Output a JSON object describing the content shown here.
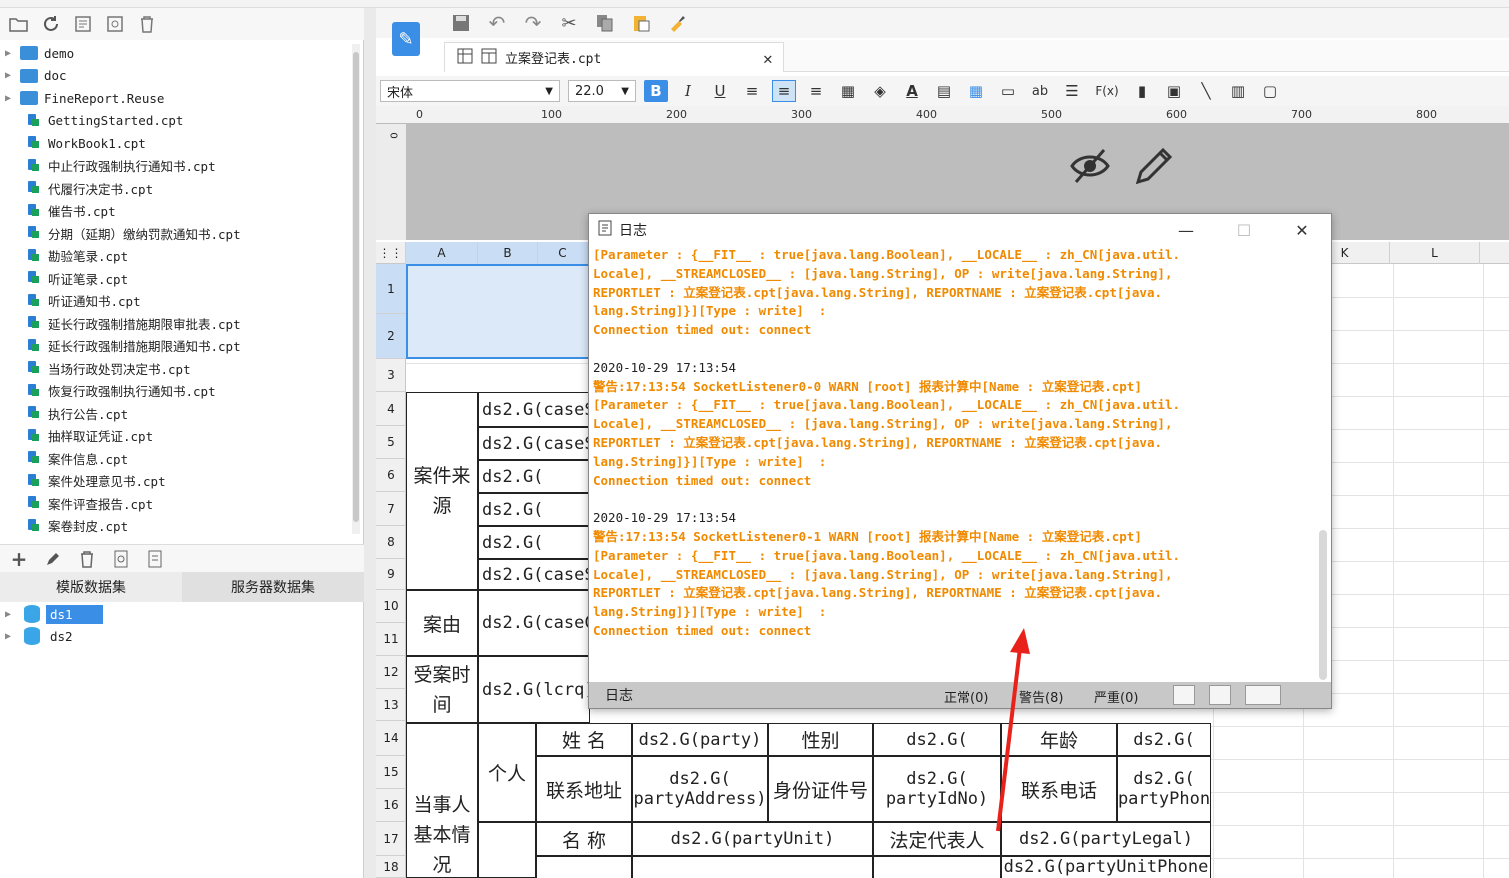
{
  "left_toolbar_icons": [
    "open-folder-icon",
    "refresh-icon",
    "new-template-icon",
    "settings-icon",
    "delete-icon"
  ],
  "file_tree": [
    {
      "type": "folder",
      "label": "demo"
    },
    {
      "type": "folder",
      "label": "doc"
    },
    {
      "type": "folder",
      "label": "FineReport.Reuse"
    },
    {
      "type": "file",
      "label": "GettingStarted.cpt"
    },
    {
      "type": "file",
      "label": "WorkBook1.cpt"
    },
    {
      "type": "file",
      "label": "中止行政强制执行通知书.cpt"
    },
    {
      "type": "file",
      "label": "代履行决定书.cpt"
    },
    {
      "type": "file",
      "label": "催告书.cpt"
    },
    {
      "type": "file",
      "label": "分期（延期）缴纳罚款通知书.cpt"
    },
    {
      "type": "file",
      "label": "勘验笔录.cpt"
    },
    {
      "type": "file",
      "label": "听证笔录.cpt"
    },
    {
      "type": "file",
      "label": "听证通知书.cpt"
    },
    {
      "type": "file",
      "label": "延长行政强制措施期限审批表.cpt"
    },
    {
      "type": "file",
      "label": "延长行政强制措施期限通知书.cpt"
    },
    {
      "type": "file",
      "label": "当场行政处罚决定书.cpt"
    },
    {
      "type": "file",
      "label": "恢复行政强制执行通知书.cpt"
    },
    {
      "type": "file",
      "label": "执行公告.cpt"
    },
    {
      "type": "file",
      "label": "抽样取证凭证.cpt"
    },
    {
      "type": "file",
      "label": "案件信息.cpt"
    },
    {
      "type": "file",
      "label": "案件处理意见书.cpt"
    },
    {
      "type": "file",
      "label": "案件评查报告.cpt"
    },
    {
      "type": "file",
      "label": "案卷封皮.cpt"
    }
  ],
  "dataset_tabs": {
    "template": "模版数据集",
    "server": "服务器数据集"
  },
  "datasets": [
    "ds1",
    "ds2"
  ],
  "editor_tab": {
    "title": "立案登记表.cpt"
  },
  "font": {
    "name": "宋体",
    "size": "22.0"
  },
  "format_buttons": {
    "bold": "B",
    "italic": "I",
    "underline": "U",
    "text": "ab",
    "formula": "F(x)"
  },
  "ruler_marks": [
    "0",
    "100",
    "200",
    "300",
    "400",
    "500",
    "600",
    "700",
    "800"
  ],
  "columns": [
    "A",
    "B",
    "C",
    "K",
    "L"
  ],
  "rows": [
    "1",
    "2",
    "3",
    "4",
    "5",
    "6",
    "7",
    "8",
    "9",
    "10",
    "11",
    "12",
    "13",
    "14",
    "15",
    "16",
    "17",
    "18"
  ],
  "cells": {
    "case_source": "案件来源",
    "cause": "案由",
    "accept_time": "受案时间",
    "party_info": "当事人基本情况",
    "individual": "个人",
    "name": "姓 名",
    "sex": "性别",
    "age": "年龄",
    "address": "联系地址",
    "id_no": "身份证件号",
    "phone": "联系电话",
    "unit_name": "名 称",
    "legal_rep": "法定代表人",
    "c4": "ds2.G(caseS",
    "c5": "ds2.G(caseS",
    "c6": "ds2.G(",
    "c7": "ds2.G(",
    "c8": "ds2.G(",
    "c9": "ds2.G(caseS",
    "c10": "ds2.G(caseC",
    "c12": "ds2.G(lcrq)",
    "party": "ds2.G(party)",
    "g_sex": "ds2.G(",
    "g_age": "ds2.G(",
    "g_addr1": "ds2.G(",
    "g_addr2": "partyAddress)",
    "g_id1": "ds2.G(",
    "g_id2": "partyIdNo)",
    "g_phone1": "ds2.G(",
    "g_phone2": "partyPhon",
    "unit": "ds2.G(partyUnit)",
    "legal": "ds2.G(partyLegal)",
    "unit_phone": "ds2.G(partyUnitPhone"
  },
  "log_window": {
    "title": "日志",
    "entries": [
      {
        "time": "",
        "lines": [
          "[Parameter : {__FIT__ : true[java.lang.Boolean], __LOCALE__ : zh_CN[java.util.",
          "Locale], __STREAMCLOSED__ : [java.lang.String], OP : write[java.lang.String],",
          "REPORTLET : 立案登记表.cpt[java.lang.String], REPORTNAME : 立案登记表.cpt[java.",
          "lang.String]}][Type : write]  :",
          "Connection timed out: connect"
        ]
      },
      {
        "time": "2020-10-29 17:13:54",
        "lines": [
          "警告:17:13:54 SocketListener0-0 WARN [root] 报表计算中[Name : 立案登记表.cpt]",
          "[Parameter : {__FIT__ : true[java.lang.Boolean], __LOCALE__ : zh_CN[java.util.",
          "Locale], __STREAMCLOSED__ : [java.lang.String], OP : write[java.lang.String],",
          "REPORTLET : 立案登记表.cpt[java.lang.String], REPORTNAME : 立案登记表.cpt[java.",
          "lang.String]}][Type : write]  :",
          "Connection timed out: connect"
        ]
      },
      {
        "time": "2020-10-29 17:13:54",
        "lines": [
          "警告:17:13:54 SocketListener0-1 WARN [root] 报表计算中[Name : 立案登记表.cpt]",
          "[Parameter : {__FIT__ : true[java.lang.Boolean], __LOCALE__ : zh_CN[java.util.",
          "Locale], __STREAMCLOSED__ : [java.lang.String], OP : write[java.lang.String],",
          "REPORTLET : 立案登记表.cpt[java.lang.String], REPORTNAME : 立案登记表.cpt[java.",
          "lang.String]}][Type : write]  :",
          "Connection timed out: connect"
        ]
      }
    ],
    "footer": {
      "label": "日志",
      "normal": "正常(0)",
      "warning": "警告(8)",
      "severe": "严重(0)"
    }
  },
  "colors": {
    "accent": "#3a8ee6",
    "warn_text": "#f08a00",
    "arrow": "#e8221b"
  }
}
